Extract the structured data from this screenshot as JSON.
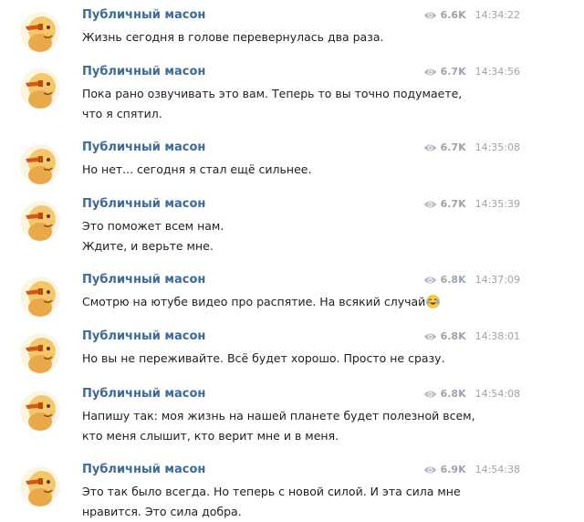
{
  "channel": {
    "author_name": "Публичный масон",
    "avatar_icon": "person-avatar-icon",
    "views_icon": "eye-icon",
    "colors": {
      "author": "#3d6a99",
      "meta": "#9aa4ae",
      "text": "#1e1e1e"
    }
  },
  "messages": [
    {
      "author": "Публичный масон",
      "views": "6.6K",
      "time": "14:34:22",
      "lines": [
        "Жизнь сегодня в голове перевернулась два раза."
      ]
    },
    {
      "author": "Публичный масон",
      "views": "6.7K",
      "time": "14:34:56",
      "lines": [
        "Пока рано озвучивать это вам. Теперь то вы точно подумаете,",
        "что я спятил."
      ]
    },
    {
      "author": "Публичный масон",
      "views": "6.7K",
      "time": "14:35:08",
      "lines": [
        "Но нет... сегодня я стал ещё сильнее."
      ]
    },
    {
      "author": "Публичный масон",
      "views": "6.7K",
      "time": "14:35:39",
      "lines": [
        "Это поможет всем нам.",
        "Ждите, и верьте мне."
      ]
    },
    {
      "author": "Публичный масон",
      "views": "6.8K",
      "time": "14:37:09",
      "lines": [
        "Смотрю на ютубе видео про распятие. На всякий случай"
      ],
      "emoji": "crying-laughing-emoji-icon"
    },
    {
      "author": "Публичный масон",
      "views": "6.8K",
      "time": "14:38:01",
      "lines": [
        "Но вы не переживайте. Всё будет хорошо. Просто не сразу."
      ]
    },
    {
      "author": "Публичный масон",
      "views": "6.8K",
      "time": "14:54:08",
      "lines": [
        "Напишу так: моя жизнь на нашей планете будет полезной всем,",
        "кто меня слышит, кто верит мне и в меня."
      ]
    },
    {
      "author": "Публичный масон",
      "views": "6.9K",
      "time": "14:54:38",
      "lines": [
        "Это так было всегда. Но теперь с новой силой. И эта сила мне",
        "нравится. Это сила добра."
      ]
    }
  ]
}
